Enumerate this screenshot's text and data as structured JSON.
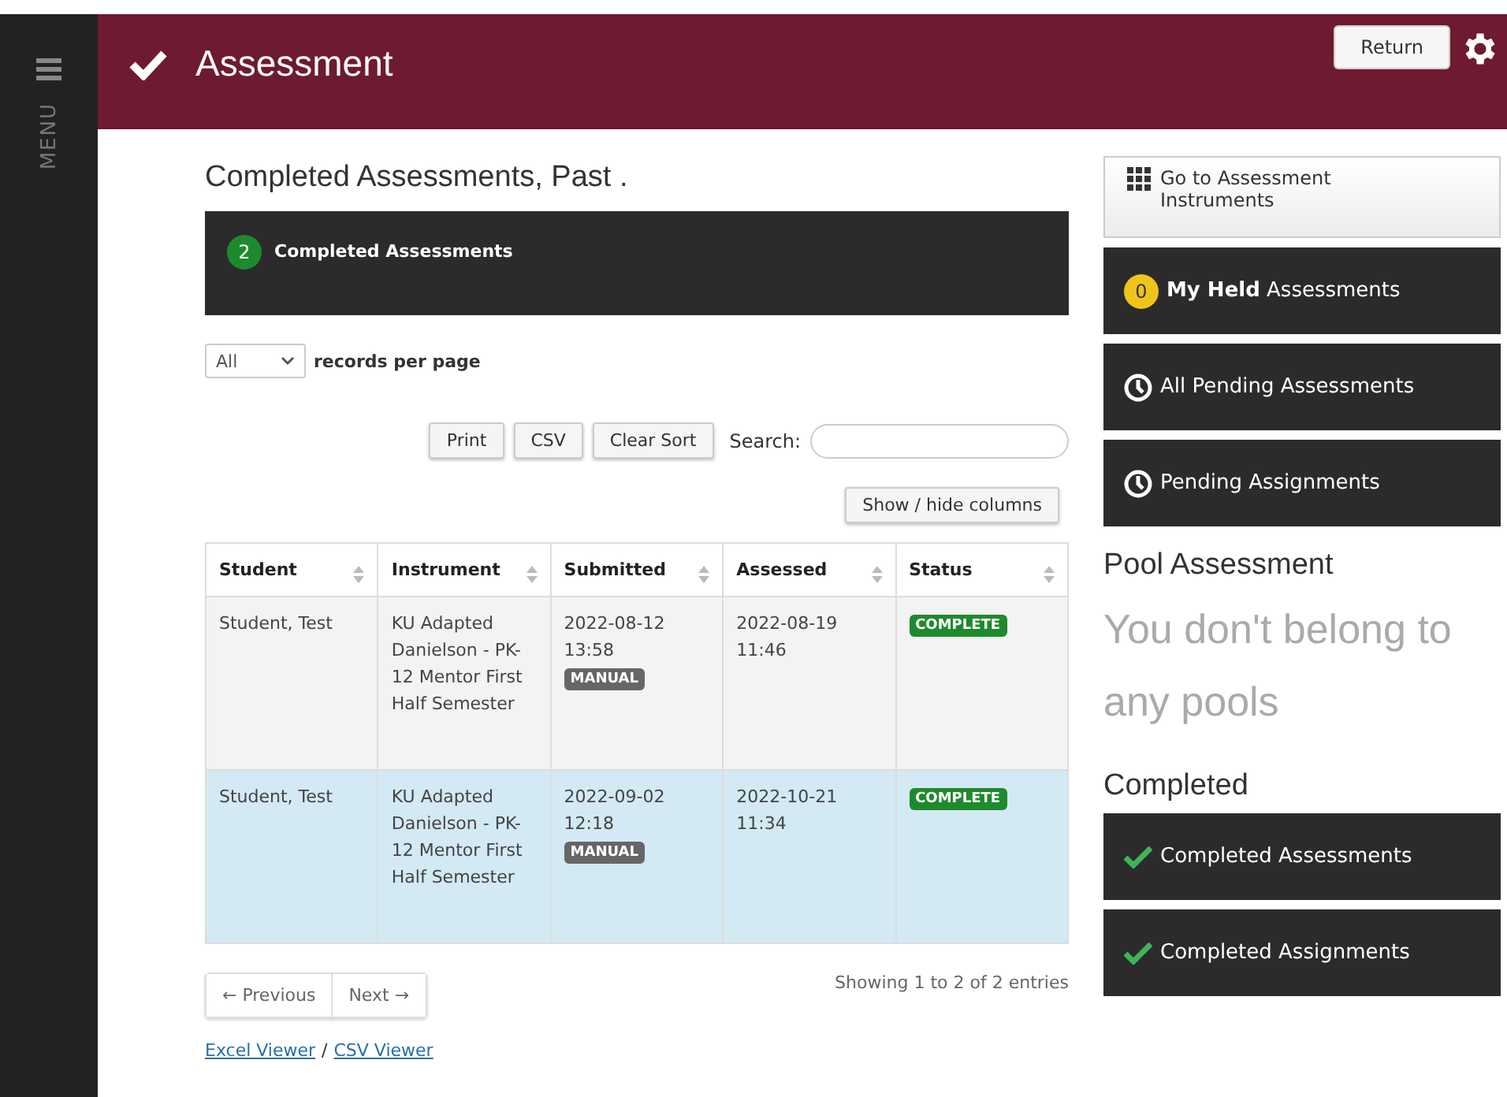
{
  "sidebar": {
    "label": "MENU"
  },
  "header": {
    "title": "Assessment",
    "return_button": "Return"
  },
  "main": {
    "heading": "Completed Assessments, Past .",
    "summary": {
      "count": "2",
      "label": "Completed Assessments"
    },
    "page_size": {
      "value": "All",
      "label": "records per page"
    },
    "toolbar": [
      "Print",
      "CSV",
      "Clear Sort"
    ],
    "search": {
      "label": "Search:"
    },
    "columns_button": "Show / hide columns",
    "table": {
      "columns": [
        "Student",
        "Instrument",
        "Submitted",
        "Assessed",
        "Status"
      ],
      "rows": [
        {
          "selected": false,
          "student": "Student, Test",
          "instrument": "KU Adapted Danielson - PK-12 Mentor First Half Semester",
          "submitted": "2022-08-12 13:58",
          "submitted_tag": "MANUAL",
          "assessed": "2022-08-19 11:46",
          "status": "COMPLETE"
        },
        {
          "selected": true,
          "student": "Student, Test",
          "instrument": "KU Adapted Danielson - PK-12 Mentor First Half Semester",
          "submitted": "2022-09-02 12:18",
          "submitted_tag": "MANUAL",
          "assessed": "2022-10-21 11:34",
          "status": "COMPLETE"
        }
      ]
    },
    "pager": {
      "previous": "← Previous",
      "next": "Next →",
      "info": "Showing 1 to 2 of 2 entries"
    },
    "viewers": {
      "excel": "Excel Viewer",
      "separator": "/",
      "csv": "CSV Viewer"
    }
  },
  "right": {
    "nav": [
      {
        "kind": "grid",
        "label": "Go to Assessment Instruments"
      },
      {
        "kind": "badge",
        "badge": "0",
        "label": "**My Held** Assessments"
      },
      {
        "kind": "clock",
        "label": "All Pending Assessments"
      },
      {
        "kind": "clock",
        "label": "Pending Assignments"
      }
    ],
    "pool": {
      "heading": "Pool Assessment",
      "message": "You don't belong to any pools"
    },
    "completed": {
      "heading": "Completed",
      "items": [
        {
          "kind": "check",
          "label": "Completed Assessments"
        },
        {
          "kind": "check",
          "label": "Completed Assignments"
        }
      ]
    }
  }
}
